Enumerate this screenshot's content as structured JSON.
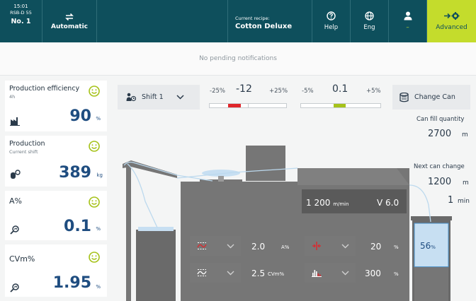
{
  "topbar": {
    "time": "15:01",
    "machine_model": "RSB-D 55",
    "machine_no": "No. 1",
    "mode_label": "Automatic",
    "recipe_caption": "Current recipe:",
    "recipe_name": "Cotton Deluxe",
    "help_label": "Help",
    "language_label": "Eng",
    "user_label": "–",
    "advanced_label": "Advanced"
  },
  "notifications": {
    "text": "No pending notifications"
  },
  "kpis": [
    {
      "title": "Production efficiency",
      "subtitle": "4h",
      "value": "90",
      "unit": "%",
      "icon": "factory-icon",
      "status": "smiley-happy-icon"
    },
    {
      "title": "Production",
      "subtitle": "Current shift",
      "value": "389",
      "unit": "kg",
      "icon": "sliver-icon",
      "status": "smiley-happy-icon"
    },
    {
      "title": "A%",
      "subtitle": "",
      "value": "0.1",
      "unit": "%",
      "icon": "magnifier-icon",
      "status": "smiley-happy-icon"
    },
    {
      "title": "CVm%",
      "subtitle": "",
      "value": "1.95",
      "unit": "%",
      "icon": "magnifier-icon",
      "status": "smiley-happy-icon"
    }
  ],
  "shift": {
    "label": "Shift 1"
  },
  "tolerance_1": {
    "min": "-25%",
    "value": "-12",
    "max": "+25%",
    "color": "#e0262b"
  },
  "tolerance_2": {
    "min": "-5%",
    "value": "0.1",
    "max": "+5%",
    "color": "#a6c21a"
  },
  "change_can": {
    "label": "Change Can"
  },
  "can_fill": {
    "label": "Can fill quantity",
    "value": "2700",
    "unit": "m"
  },
  "next_can": {
    "label": "Next can change",
    "value": "1200",
    "unit": "m",
    "time_value": "1",
    "time_unit": "min"
  },
  "machine": {
    "speed_value": "1 200",
    "speed_unit": "m/min",
    "version": "V 6.0",
    "can_fill_percent": "56",
    "can_fill_unit": "%",
    "can_fill_fraction": 0.56
  },
  "settings": [
    {
      "icon": "wave-chart-icon",
      "value": "2.0",
      "unit": "A%"
    },
    {
      "icon": "wave-chart-icon",
      "value": "2.5",
      "unit": "CVm%"
    },
    {
      "icon": "split-arrows-icon",
      "value": "20",
      "unit": "%"
    },
    {
      "icon": "bar-histogram-icon",
      "value": "300",
      "unit": "%"
    }
  ],
  "colors": {
    "header": "#0e4f5c",
    "advanced": "#c4dc2c",
    "machine": "#767676",
    "accent_blue": "#1f4d80",
    "smiley": "#a6c21a"
  }
}
